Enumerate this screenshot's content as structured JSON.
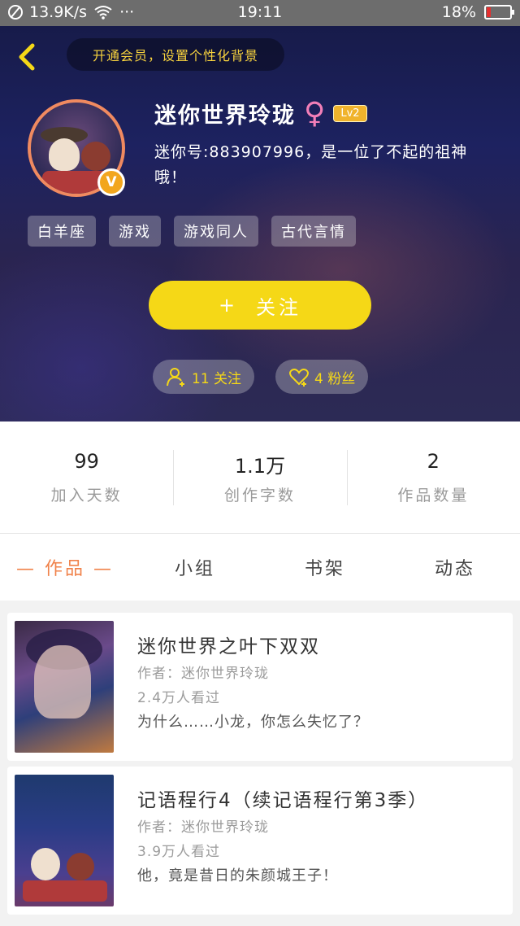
{
  "status_bar": {
    "speed": "13.9K/s",
    "dots": "···",
    "time": "19:11",
    "battery": "18%",
    "battery_level": 0.18
  },
  "header": {
    "vip_banner": "开通会员，设置个性化背景",
    "name": "迷你世界玲珑",
    "gender_symbol": "♀",
    "level": "Lv2",
    "vip_badge": "V",
    "bio": "迷你号:883907996，是一位了不起的祖神哦！",
    "tags": [
      "白羊座",
      "游戏",
      "游戏同人",
      "古代言情"
    ],
    "follow_button": {
      "icon": "+",
      "label": "关注"
    },
    "following_chip": "11 关注",
    "fans_chip": "4 粉丝"
  },
  "stats": [
    {
      "value": "99",
      "label": "加入天数"
    },
    {
      "value": "1.1万",
      "label": "创作字数"
    },
    {
      "value": "2",
      "label": "作品数量"
    }
  ],
  "tabs": [
    "— 作品 —",
    "小组",
    "书架",
    "动态"
  ],
  "works": [
    {
      "title": "迷你世界之叶下双双",
      "author": "作者：迷你世界玲珑",
      "views": "2.4万人看过",
      "desc": "为什么……小龙，你怎么失忆了？"
    },
    {
      "title": "记语程行4（续记语程行第3季）",
      "author": "作者：迷你世界玲珑",
      "views": "3.9万人看过",
      "desc": "他，竟是昔日的朱颜城王子！"
    }
  ],
  "colors": {
    "accent_yellow": "#f5d817",
    "tab_active": "#f0824a",
    "gender_pink": "#f27fb8"
  }
}
